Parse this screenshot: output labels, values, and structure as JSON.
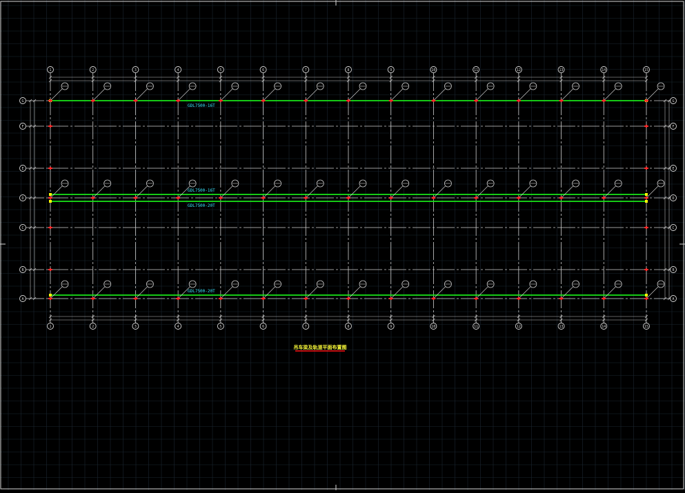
{
  "colors": {
    "background": "#000000",
    "bg_grid": "#1b2631",
    "frame": "#d8d8d8",
    "axis": "#cfcfcf",
    "dim": "#bdbdbd",
    "beam": "#19e619",
    "beam_label": "#39e6ff",
    "column": "#ff2a2a",
    "end_post": "#ffff00",
    "title_text": "#ffff3a",
    "title_underline": "#ff1010"
  },
  "grid_x_labels": [
    "1",
    "2",
    "3",
    "4",
    "5",
    "6",
    "7",
    "8",
    "9",
    "10",
    "11",
    "12",
    "13",
    "14",
    "15"
  ],
  "grid_y_labels": [
    "G",
    "F",
    "E",
    "D",
    "C",
    "B",
    "A"
  ],
  "beams": [
    {
      "label": "GDL7500-16T",
      "row": "G",
      "side": "above"
    },
    {
      "label": "GDL7500-16T",
      "row": "D",
      "side": "above"
    },
    {
      "label": "GDL7500-20T",
      "row": "D",
      "side": "below"
    },
    {
      "label": "GDL7500-20T",
      "row": "A",
      "side": "above"
    }
  ],
  "callout_rows": [
    "G",
    "D",
    "A"
  ],
  "drawing_title": "吊车梁及轨道平面布置图"
}
